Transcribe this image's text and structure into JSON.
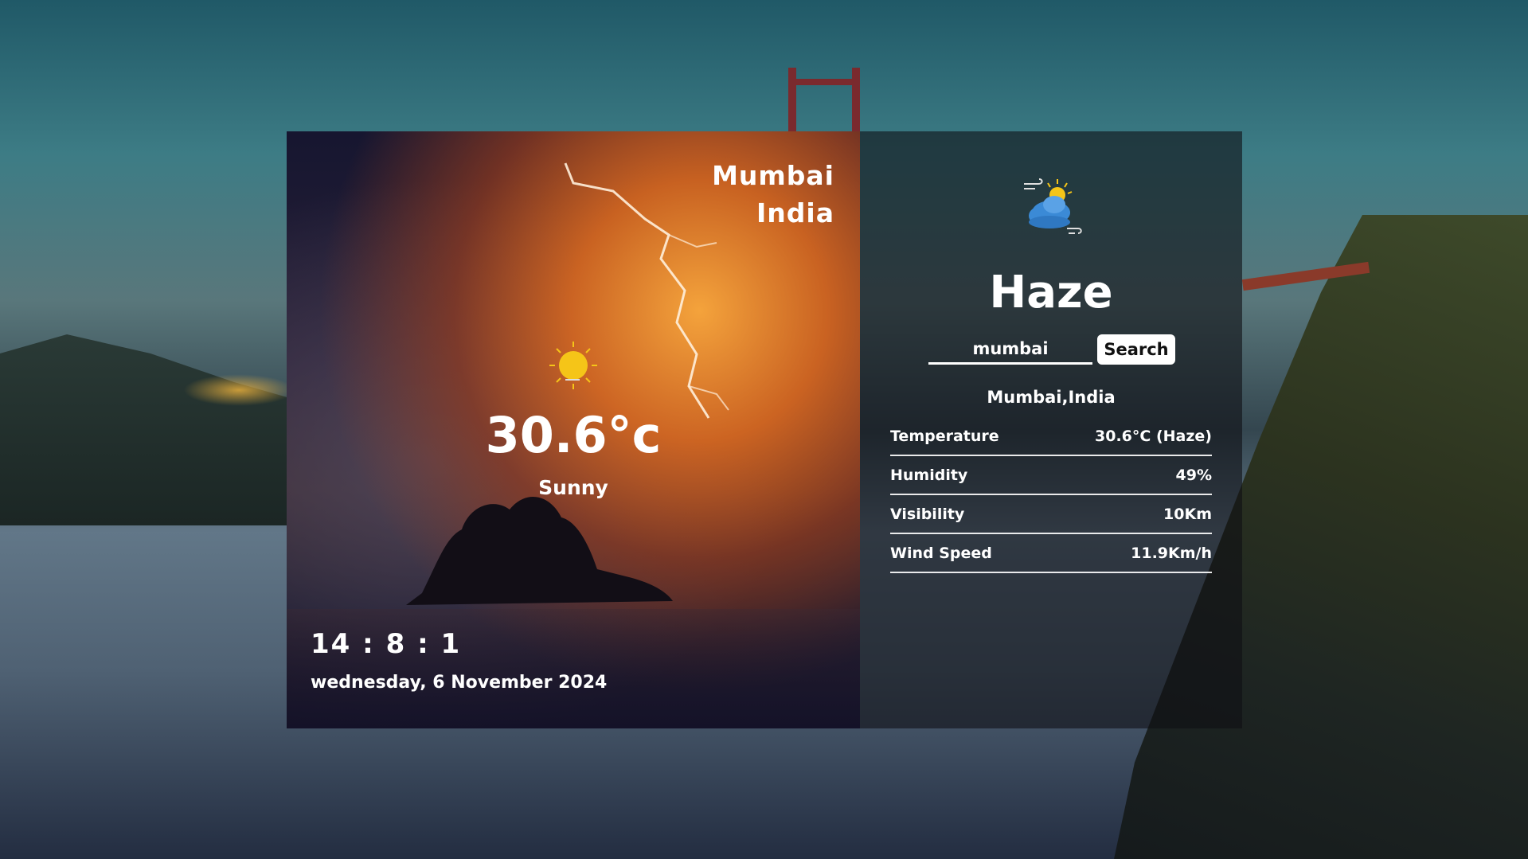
{
  "left": {
    "city": "Mumbai",
    "country": "India",
    "temperature": "30.6°c",
    "condition": "Sunny",
    "time": "14 : 8 : 1",
    "date": "wednesday, 6 November 2024",
    "icon": "sun-icon"
  },
  "right": {
    "icon": "haze-cloud-sun-wind-icon",
    "headline": "Haze",
    "search": {
      "value": "mumbai",
      "button_label": "Search"
    },
    "location": "Mumbai,India",
    "stats": [
      {
        "label": "Temperature",
        "value": "30.6°C (Haze)"
      },
      {
        "label": "Humidity",
        "value": "49%"
      },
      {
        "label": "Visibility",
        "value": "10Km"
      },
      {
        "label": "Wind Speed",
        "value": "11.9Km/h"
      }
    ]
  },
  "colors": {
    "text": "#ffffff",
    "button_bg": "#ffffff",
    "sun": "#f5c518",
    "cloud": "#3b8ad6"
  }
}
